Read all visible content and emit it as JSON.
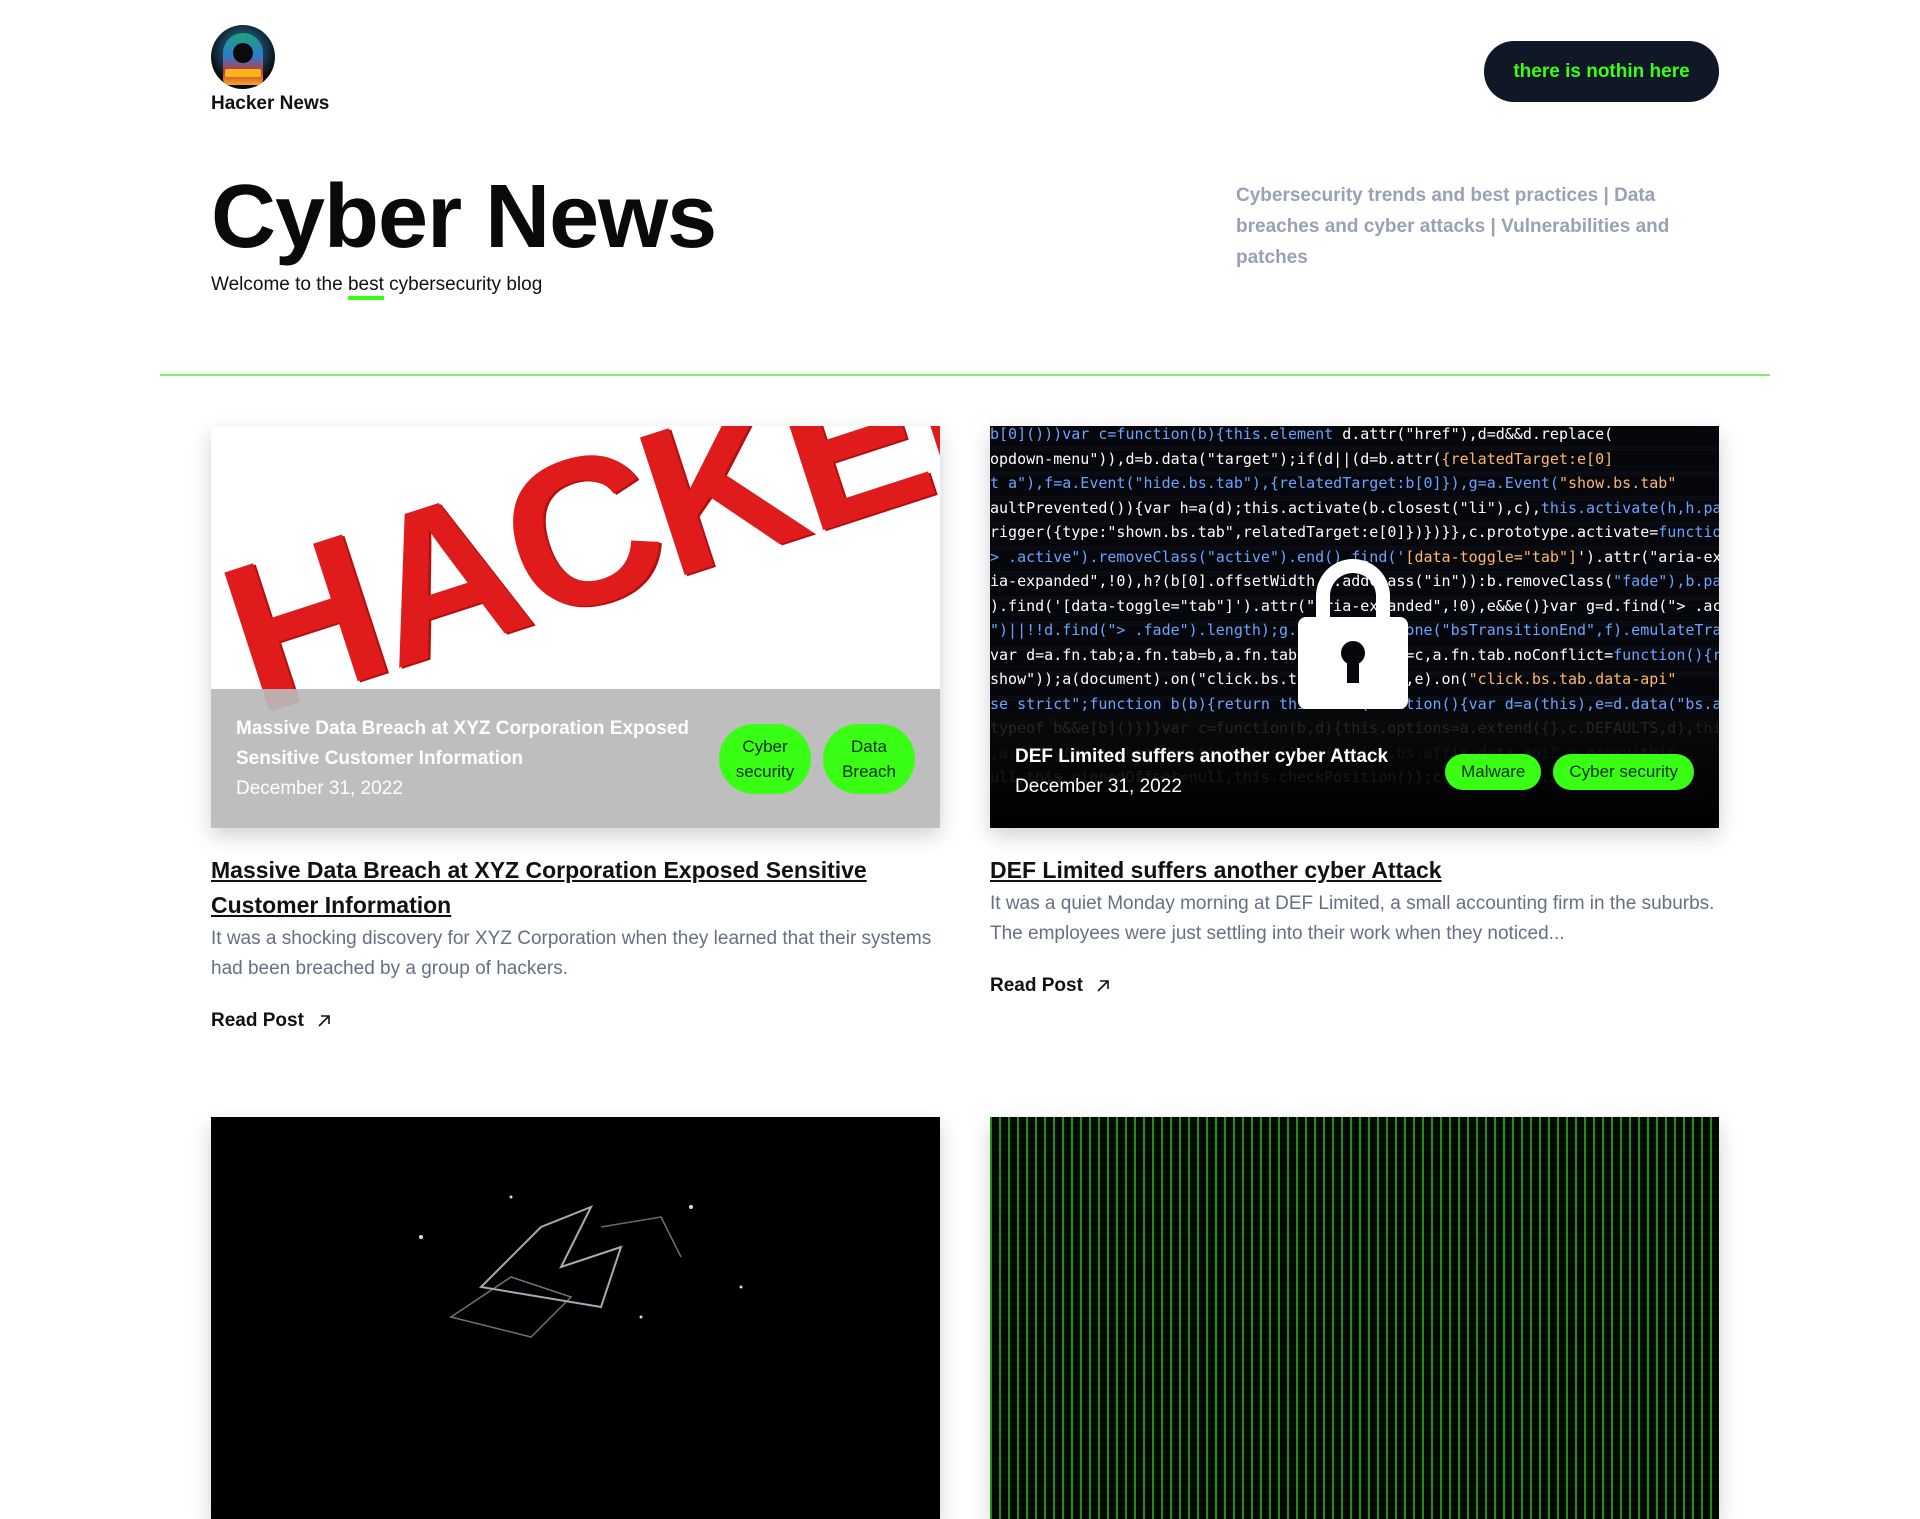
{
  "header": {
    "brand": "Hacker News",
    "cta_label": "there is nothin here"
  },
  "hero": {
    "title": "Cyber News",
    "subtitle_pre": "Welcome to the ",
    "subtitle_highlight": "best",
    "subtitle_post": " cybersecurity blog",
    "tagline": "Cybersecurity trends and best practices | Data breaches and cyber attacks | Vulnerabilities and patches"
  },
  "colors": {
    "accent": "#39ff14",
    "dark": "#101828",
    "muted": "#98a2b3"
  },
  "posts": [
    {
      "image_label": "HACKED",
      "overlay_title": "Massive Data Breach at XYZ Corporation Exposed Sensitive Customer Information",
      "date": "December 31, 2022",
      "tags": [
        "Cyber security",
        "Data Breach"
      ],
      "title": "Massive Data Breach at XYZ Corporation Exposed Sensitive Customer Information",
      "excerpt": "It was a shocking discovery for XYZ Corporation when they learned that their systems had been breached by a group of hackers.",
      "read_label": "Read Post"
    },
    {
      "overlay_title": "DEF Limited suffers another cyber Attack",
      "date": "December 31, 2022",
      "tags": [
        "Malware",
        "Cyber security"
      ],
      "title": "DEF Limited suffers another cyber Attack",
      "excerpt": "It was a quiet Monday morning at DEF Limited, a small accounting firm in the suburbs. The employees were just settling into their work when they noticed...",
      "read_label": "Read Post"
    }
  ]
}
